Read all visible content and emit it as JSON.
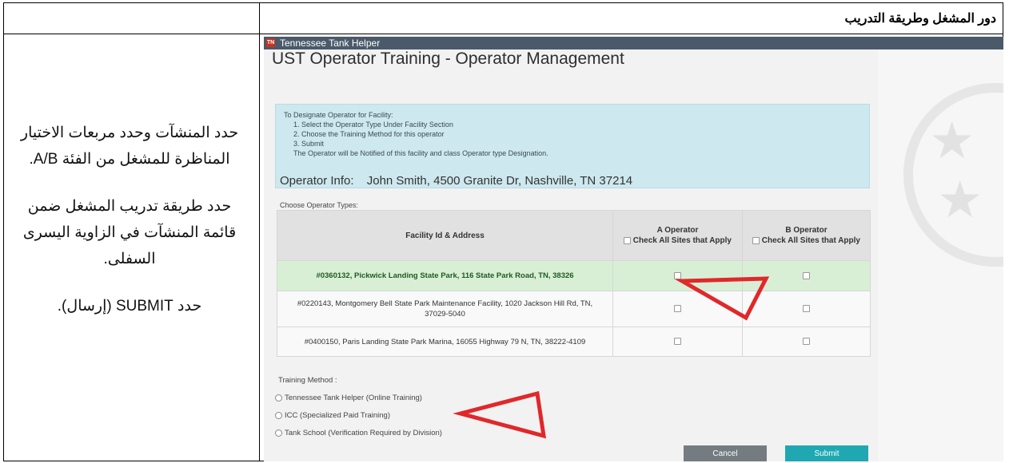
{
  "document": {
    "header_title": "دور المشغل وطريقة التدريب",
    "instructions": [
      "حدد المنشآت وحدد مربعات الاختيار المناظرة للمشغل من الفئة A/B.",
      "حدد طريقة تدريب المشغل ضمن قائمة المنشآت في الزاوية اليسرى السفلى.",
      "حدد SUBMIT (إرسال)."
    ]
  },
  "app": {
    "badge": "TN",
    "name": "Tennessee Tank Helper",
    "page_title": "UST Operator Training - Operator Management",
    "info_lines": [
      "To Designate Operator for Facility:",
      "1. Select the Operator Type Under Facility Section",
      "2. Choose the Training Method for this operator",
      "3. Submit",
      "The Operator will be Notified of this facility and class Operator type Designation."
    ],
    "operator_info_label": "Operator Info:",
    "operator_info_value": "John Smith, 4500 Granite Dr, Nashville, TN 37214",
    "choose_types_label": "Choose Operator Types:",
    "table": {
      "col_facility": "Facility Id & Address",
      "col_a_title": "A Operator",
      "col_a_check": "Check All Sites that Apply",
      "col_b_title": "B Operator",
      "col_b_check": "Check All Sites that Apply",
      "rows": [
        {
          "facility": "#0360132, Pickwick Landing State Park, 116 State Park Road, TN, 38326",
          "selected": true
        },
        {
          "facility": "#0220143, Montgomery Bell State Park Maintenance Facility, 1020 Jackson Hill Rd, TN, 37029-5040",
          "selected": false
        },
        {
          "facility": "#0400150, Paris Landing State Park Marina, 16055 Highway 79 N, TN, 38222-4109",
          "selected": false
        }
      ]
    },
    "training_method_label": "Training Method :",
    "training_options": [
      "Tennessee Tank Helper (Online Training)",
      "ICC (Specialized Paid Training)",
      "Tank School (Verification Required by Division)"
    ],
    "cancel_label": "Cancel",
    "submit_label": "Submit",
    "arrow_color": "#e0282a",
    "accent_color": "#1fa8b2"
  }
}
